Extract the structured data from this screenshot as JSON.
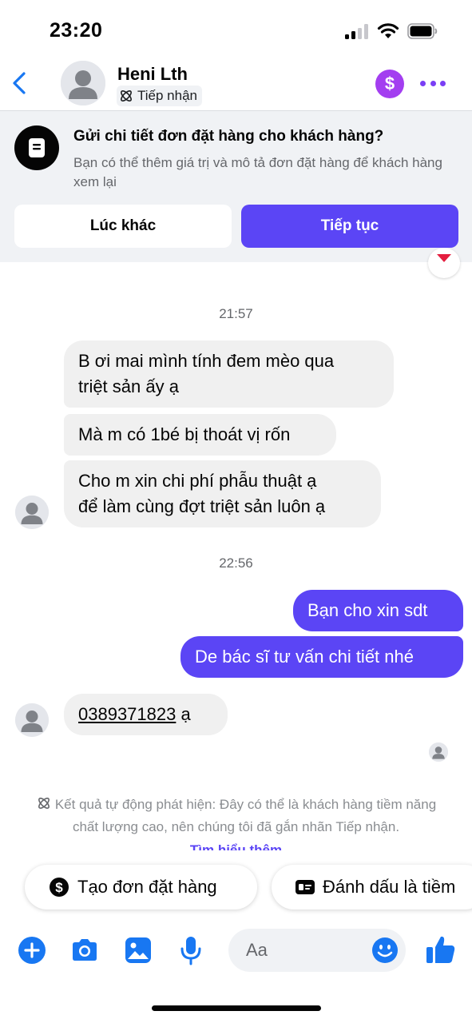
{
  "status_bar": {
    "time": "23:20"
  },
  "header": {
    "contact_name": "Heni Lth",
    "tag_label": "Tiếp nhận",
    "dollar_symbol": "$"
  },
  "banner": {
    "title": "Gửi chi tiết đơn đặt hàng cho khách hàng?",
    "description": "Bạn có thể thêm giá trị và mô tả đơn đặt hàng để khách hàng xem lại",
    "later_label": "Lúc khác",
    "continue_label": "Tiếp tục"
  },
  "conversation": {
    "timestamp_1": "21:57",
    "incoming_1": [
      "B ơi mai mình tính đem mèo qua",
      "triệt sản ấy ạ"
    ],
    "incoming_2": "Mà m có 1bé bị thoát vị rốn",
    "incoming_3": [
      "Cho m xin chi phí phẫu thuật ạ",
      "để làm cùng đợt triệt sản luôn ạ"
    ],
    "timestamp_2": "22:56",
    "outgoing_1": "Bạn cho xin sdt",
    "outgoing_2": "De bác sĩ tư vấn chi tiết nhé",
    "incoming_4_phone": "0389371823",
    "incoming_4_suffix": " ạ"
  },
  "notice": {
    "text": "Kết quả tự động phát hiện: Đây có thể là khách hàng tiềm năng chất lượng cao, nên chúng tôi đã gắn nhãn Tiếp nhận.",
    "link": "Tìm hiểu thêm"
  },
  "quick_actions": {
    "create_order": "Tạo đơn đặt hàng",
    "mark_potential": "Đánh dấu là tiềm"
  },
  "composer": {
    "placeholder": "Aa"
  },
  "colors": {
    "accent": "#5b45f5",
    "incoming_bubble": "#f0f0f0",
    "composer_blue": "#1877f2",
    "dollar_purple": "#a33ef0",
    "heart_red": "#e41e3f"
  },
  "icons": [
    "back-icon",
    "avatar-icon",
    "ai-tag-icon",
    "dollar-icon",
    "more-icon",
    "order-icon",
    "heart-icon",
    "plus-icon",
    "camera-icon",
    "image-icon",
    "mic-icon",
    "emoji-icon",
    "like-icon",
    "tag-card-icon"
  ]
}
